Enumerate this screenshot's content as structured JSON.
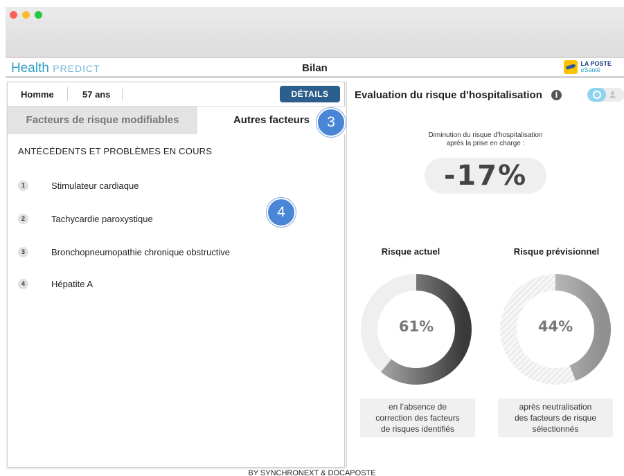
{
  "window": {
    "controls": [
      "close",
      "minimize",
      "zoom"
    ]
  },
  "app": {
    "brand_main": "Health",
    "brand_sub": "PREDICT",
    "page_title": "Bilan",
    "partner_line1": "LA POSTE",
    "partner_line2": "eSanté"
  },
  "patient": {
    "sex": "Homme",
    "age": "57 ans",
    "details_label": "DÉTAILS"
  },
  "tabs": [
    {
      "label": "Facteurs de risque modifiables",
      "active": false
    },
    {
      "label": "Autres facteurs",
      "active": true
    }
  ],
  "badges": {
    "tab_marker": "3",
    "list_marker": "4"
  },
  "history": {
    "title": "ANTÉCÉDENTS ET PROBLÈMES EN COURS",
    "items": [
      {
        "num": "1",
        "label": "Stimulateur cardiaque"
      },
      {
        "num": "2",
        "label": "Tachycardie paroxystique"
      },
      {
        "num": "3",
        "label": "Bronchopneumopathie chronique obstructive"
      },
      {
        "num": "4",
        "label": "Hépatite A"
      }
    ]
  },
  "evaluation": {
    "title": "Evaluation du risque d’hospitalisation",
    "info_icon": "i",
    "reduction_line1": "Diminution du risque d’hospitalisation",
    "reduction_line2": "après la prise en charge :",
    "reduction_value": "-17%",
    "current": {
      "label": "Risque actuel",
      "value_text": "61%",
      "value": 0.61,
      "caption_lines": [
        "en l’absence de",
        "correction des facteurs",
        "de risques identifiés"
      ]
    },
    "forecast": {
      "label": "Risque prévisionnel",
      "value_text": "44%",
      "value": 0.44,
      "caption_lines": [
        "après neutralisation",
        "des facteurs de risque",
        "sélectionnés"
      ]
    }
  },
  "footer": "BY SYNCHRONEXT & DOCAPOSTE",
  "colors": {
    "brand_blue": "#2e9fc4",
    "details_button": "#2b5e8c",
    "badge_blue": "#4a86d6",
    "ring_dark": "#4a4a4a",
    "ring_light": "#efefef"
  }
}
